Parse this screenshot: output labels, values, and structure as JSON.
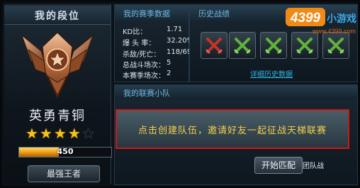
{
  "rank_panel": {
    "title": "我的段位",
    "rank_name": "英勇青铜",
    "stars_total": 5,
    "stars_filled": 4,
    "progress_text": "450",
    "progress_fraction": 0.43,
    "king_button_label": "最强王者"
  },
  "season_stats": {
    "title": "我的赛季数据",
    "rows": [
      {
        "label": "KD比：",
        "value": "1.71"
      },
      {
        "label": "爆 头 率：",
        "value": "32.20%"
      },
      {
        "label": "杀敌/死亡：",
        "value": "118/69"
      },
      {
        "label": "总战斗场次：",
        "value": "5"
      },
      {
        "label": "本赛季场次：",
        "value": "2"
      }
    ]
  },
  "history": {
    "title": "历史战绩",
    "results": [
      "loss",
      "win",
      "win",
      "win",
      "win"
    ],
    "link_text": "详细历史数据"
  },
  "team": {
    "title": "我的联赛小队",
    "invite_text": "点击创建队伍，邀请好友一起征战天梯联赛",
    "start_button_label": "开始匹配",
    "team_battle_label": "团队战"
  },
  "logo": {
    "main": "4399",
    "suffix": "小游戏",
    "url": "www.4399.com"
  },
  "colors": {
    "loss": "#c8312a",
    "win": "#5fb23a",
    "accent_red": "#d21616",
    "gold": "#f6c318"
  }
}
